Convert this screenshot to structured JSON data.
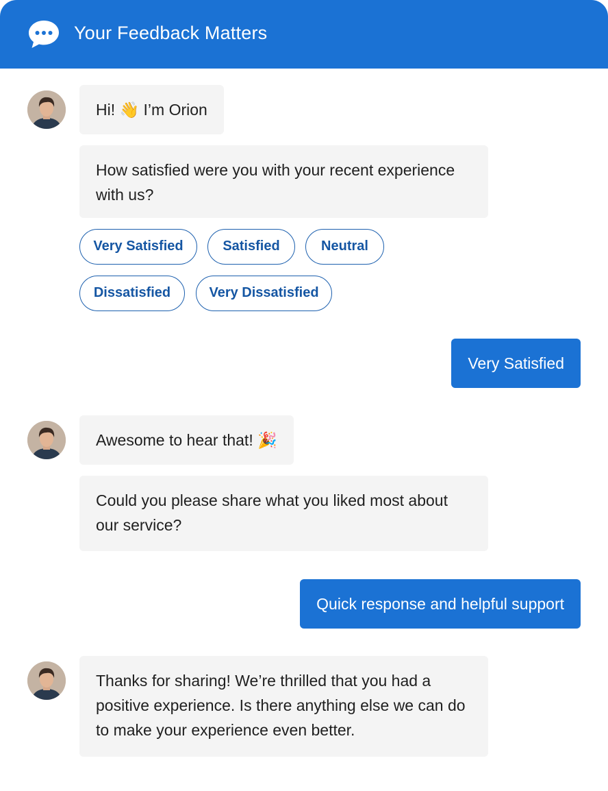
{
  "header": {
    "title": "Your Feedback Matters",
    "icon": "chat-bubble-icon",
    "color": "#1b72d4"
  },
  "messages": {
    "greeting": "Hi! 👋 I’m Orion",
    "question1": "How satisfied were you with your recent experience with us?",
    "options": [
      "Very Satisfied",
      "Satisfied",
      "Neutral",
      "Dissatisfied",
      "Very Dissatisfied"
    ],
    "user_reply1": "Very Satisfied",
    "reaction": "Awesome to hear that! 🎉",
    "question2": "Could you please share what you liked most about our service?",
    "user_reply2": "Quick response and helpful support",
    "closing": "Thanks for sharing! We’re thrilled that you had a positive experience. Is there anything else we can do to make your experience even better."
  },
  "colors": {
    "accent": "#1b72d4",
    "bot_bubble": "#f4f4f4",
    "chip_border": "#1b5fae",
    "chip_text": "#1556a3"
  }
}
